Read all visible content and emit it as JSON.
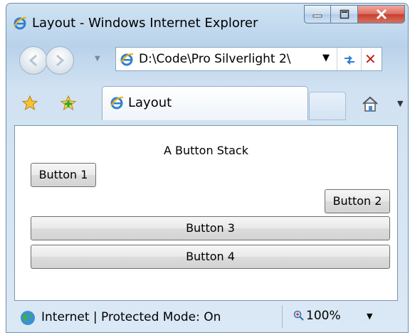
{
  "window": {
    "title": "Layout - Windows Internet Explorer"
  },
  "address": {
    "url": "D:\\Code\\Pro Silverlight 2\\"
  },
  "tabs": [
    {
      "label": "Layout"
    }
  ],
  "page": {
    "heading": "A Button Stack",
    "buttons": [
      {
        "label": "Button 1"
      },
      {
        "label": "Button 2"
      },
      {
        "label": "Button 3"
      },
      {
        "label": "Button 4"
      }
    ]
  },
  "status": {
    "zone": "Internet | Protected Mode: On",
    "zoom": "100%"
  },
  "icons": {
    "app": "ie-logo-icon",
    "back": "back-icon",
    "forward": "forward-icon",
    "refresh": "refresh-icon",
    "stop": "stop-icon",
    "favorites": "favorites-star-icon",
    "add_favorites": "add-favorites-icon",
    "home": "home-icon",
    "zone": "globe-icon",
    "zoom": "zoom-icon"
  },
  "colors": {
    "close_button": "#c6402f",
    "stop": "#c0201b",
    "chrome": "#b9d2ea"
  }
}
